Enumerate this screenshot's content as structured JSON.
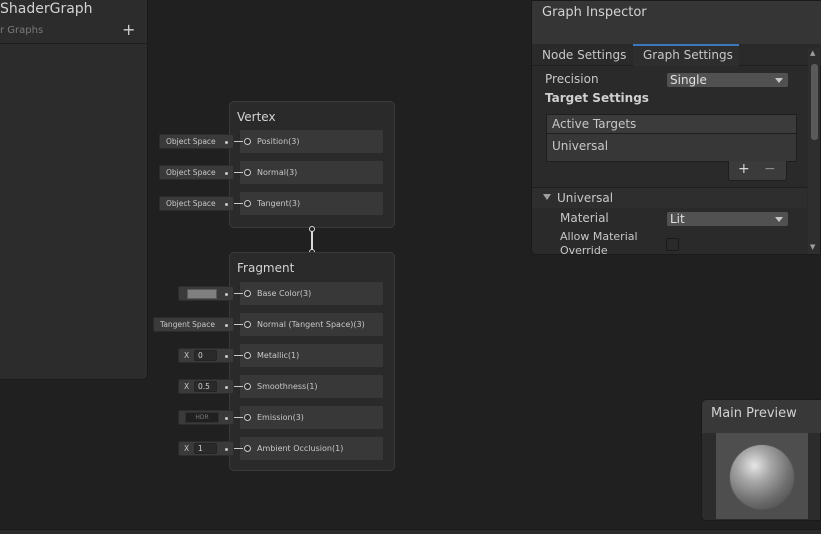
{
  "blackboard": {
    "title": "ShaderGraph",
    "subtitle": "r Graphs",
    "add_label": "+"
  },
  "vertex": {
    "title": "Vertex",
    "blocks": [
      {
        "label": "Position(3)",
        "input": "Object Space"
      },
      {
        "label": "Normal(3)",
        "input": "Object Space"
      },
      {
        "label": "Tangent(3)",
        "input": "Object Space"
      }
    ]
  },
  "fragment": {
    "title": "Fragment",
    "blocks": [
      {
        "label": "Base Color(3)",
        "input_type": "color",
        "color": "#7f7f7f"
      },
      {
        "label": "Normal (Tangent Space)(3)",
        "input": "Tangent Space"
      },
      {
        "label": "Metallic(1)",
        "axis": "X",
        "value": "0"
      },
      {
        "label": "Smoothness(1)",
        "axis": "X",
        "value": "0.5"
      },
      {
        "label": "Emission(3)",
        "input_type": "hdr-color",
        "hdr_label": "HDR"
      },
      {
        "label": "Ambient Occlusion(1)",
        "axis": "X",
        "value": "1"
      }
    ]
  },
  "inspector": {
    "title": "Graph Inspector",
    "tabs": [
      "Node Settings",
      "Graph Settings"
    ],
    "active_tab": "Graph Settings",
    "precision": {
      "label": "Precision",
      "value": "Single"
    },
    "target_settings_label": "Target Settings",
    "active_targets": {
      "header": "Active Targets",
      "items": [
        "Universal"
      ],
      "add_label": "+",
      "remove_label": "−"
    },
    "universal_section": {
      "label": "Universal",
      "material": {
        "label": "Material",
        "value": "Lit"
      },
      "allow_override": {
        "label_line1": "Allow Material",
        "label_line2": "Override",
        "checked": false
      }
    },
    "scroll_up": "▲",
    "scroll_down": "▼"
  },
  "preview": {
    "title": "Main Preview"
  },
  "colors": {
    "background": "#202020",
    "panel": "#2a2a2a",
    "accent_tab": "#3a79bb"
  }
}
